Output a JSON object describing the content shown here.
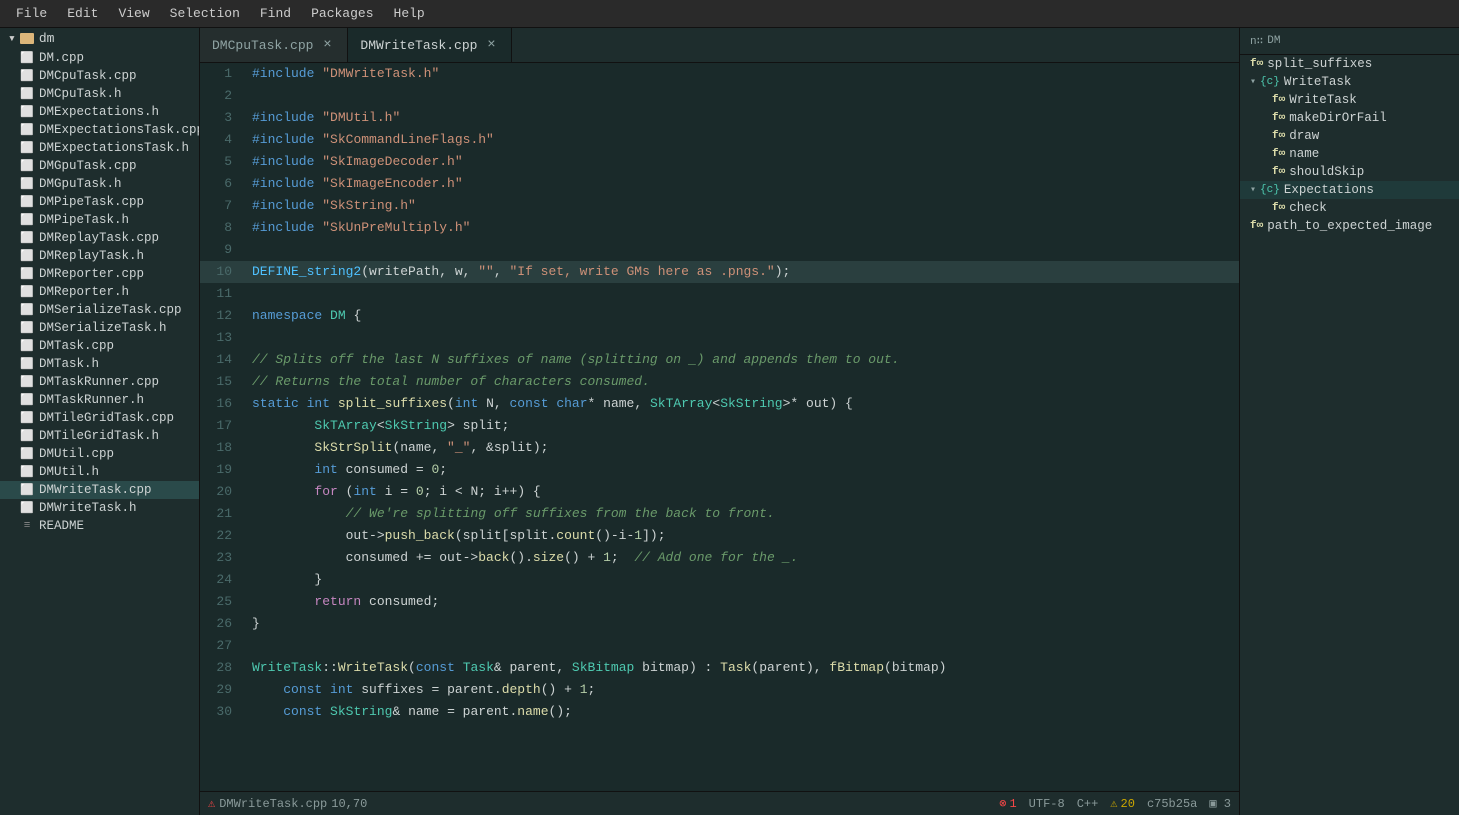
{
  "menubar": {
    "items": [
      "File",
      "Edit",
      "View",
      "Selection",
      "Find",
      "Packages",
      "Help"
    ]
  },
  "sidebar": {
    "folder": "dm",
    "files": [
      {
        "name": "DM.cpp",
        "type": "cpp"
      },
      {
        "name": "DMCpuTask.cpp",
        "type": "cpp"
      },
      {
        "name": "DMCpuTask.h",
        "type": "h"
      },
      {
        "name": "DMExpectations.h",
        "type": "h"
      },
      {
        "name": "DMExpectationsTask.cpp",
        "type": "cpp"
      },
      {
        "name": "DMExpectationsTask.h",
        "type": "h"
      },
      {
        "name": "DMGpuTask.cpp",
        "type": "cpp"
      },
      {
        "name": "DMGpuTask.h",
        "type": "h"
      },
      {
        "name": "DMPipeTask.cpp",
        "type": "cpp"
      },
      {
        "name": "DMPipeTask.h",
        "type": "h"
      },
      {
        "name": "DMReplayTask.cpp",
        "type": "cpp"
      },
      {
        "name": "DMReplayTask.h",
        "type": "h"
      },
      {
        "name": "DMReporter.cpp",
        "type": "cpp"
      },
      {
        "name": "DMReporter.h",
        "type": "h"
      },
      {
        "name": "DMSerializeTask.cpp",
        "type": "cpp"
      },
      {
        "name": "DMSerializeTask.h",
        "type": "h"
      },
      {
        "name": "DMTask.cpp",
        "type": "cpp"
      },
      {
        "name": "DMTask.h",
        "type": "h"
      },
      {
        "name": "DMTaskRunner.cpp",
        "type": "cpp"
      },
      {
        "name": "DMTaskRunner.h",
        "type": "h"
      },
      {
        "name": "DMTileGridTask.cpp",
        "type": "cpp"
      },
      {
        "name": "DMTileGridTask.h",
        "type": "h"
      },
      {
        "name": "DMUtil.cpp",
        "type": "cpp"
      },
      {
        "name": "DMUtil.h",
        "type": "h"
      },
      {
        "name": "DMWriteTask.cpp",
        "type": "cpp",
        "active": true
      },
      {
        "name": "DMWriteTask.h",
        "type": "h"
      },
      {
        "name": "README",
        "type": "readme"
      }
    ]
  },
  "tabs": [
    {
      "name": "DMCpuTask.cpp",
      "active": false
    },
    {
      "name": "DMWriteTask.cpp",
      "active": true
    }
  ],
  "statusbar": {
    "filename": "DMWriteTask.cpp",
    "position": "10,70",
    "encoding": "UTF-8",
    "language": "C++",
    "errors": "1",
    "warnings": "20",
    "git": "c75b25a",
    "indent": "3"
  },
  "outline": {
    "header": "n:: DM",
    "items": [
      {
        "label": "split_suffixes",
        "type": "fn",
        "indent": 0
      },
      {
        "label": "WriteTask",
        "type": "class",
        "indent": 0,
        "expanded": true
      },
      {
        "label": "WriteTask",
        "type": "fn",
        "indent": 1
      },
      {
        "label": "makeDirOrFail",
        "type": "fn",
        "indent": 1
      },
      {
        "label": "draw",
        "type": "fn",
        "indent": 1
      },
      {
        "label": "name",
        "type": "fn",
        "indent": 1
      },
      {
        "label": "shouldSkip",
        "type": "fn",
        "indent": 1
      },
      {
        "label": "Expectations",
        "type": "class",
        "indent": 0,
        "expanded": true,
        "active": true
      },
      {
        "label": "check",
        "type": "fn",
        "indent": 1
      },
      {
        "label": "path_to_expected_image",
        "type": "fn",
        "indent": 0
      }
    ]
  }
}
